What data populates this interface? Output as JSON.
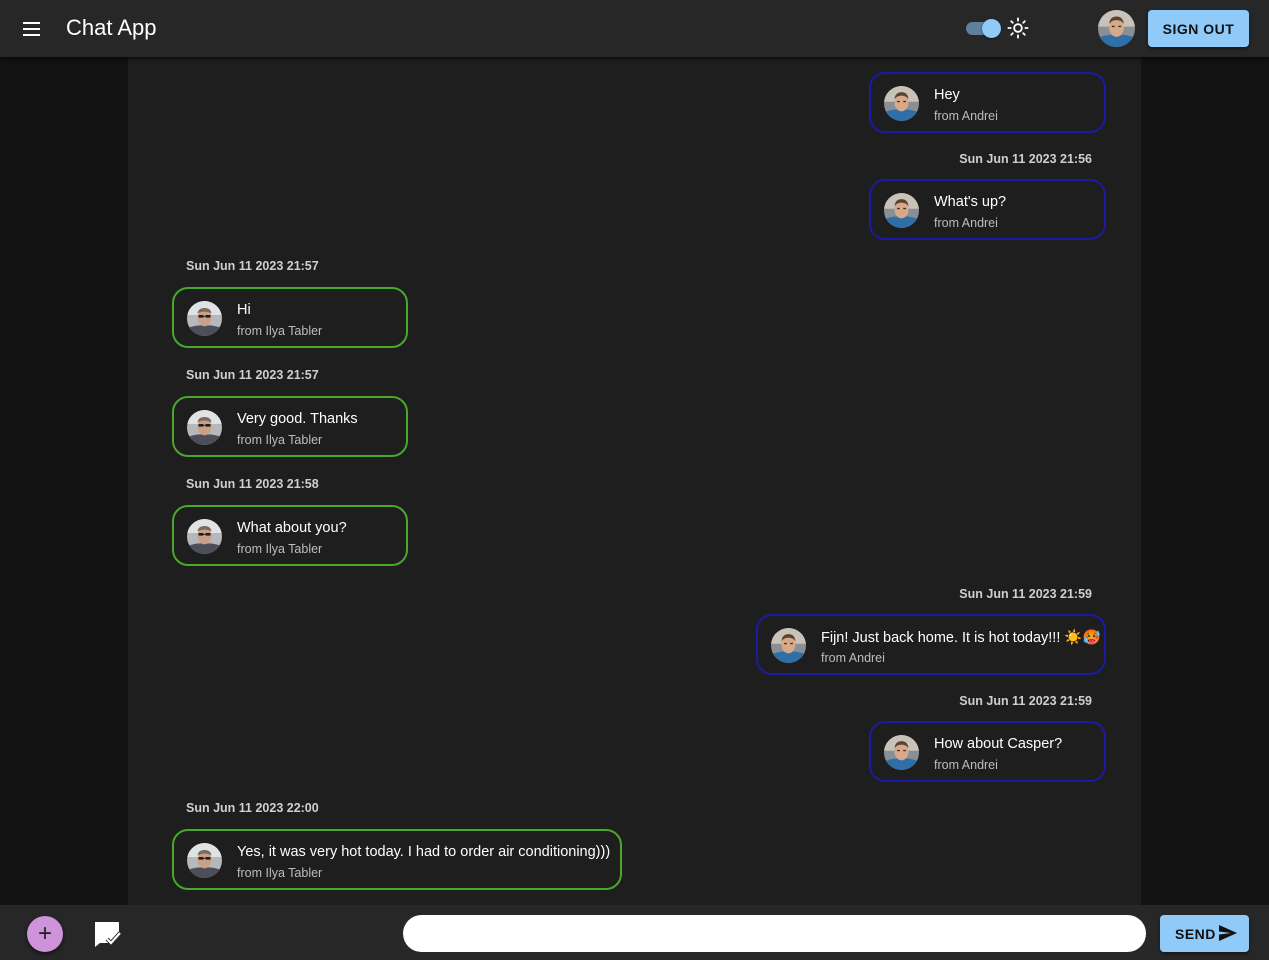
{
  "app": {
    "title": "Chat App"
  },
  "header": {
    "sign_out_label": "SIGN OUT",
    "theme_toggle": "on",
    "theme_icon": "sun-icon"
  },
  "messages": [
    {
      "id": "m1",
      "side": "mine",
      "timestamp": "",
      "text": "Hey",
      "from": "from Andrei"
    },
    {
      "id": "m2",
      "side": "mine",
      "timestamp": "Sun Jun 11 2023 21:56",
      "text": "What's up?",
      "from": "from Andrei"
    },
    {
      "id": "m3",
      "side": "theirs",
      "timestamp": "Sun Jun 11 2023 21:57",
      "text": "Hi",
      "from": "from Ilya Tabler"
    },
    {
      "id": "m4",
      "side": "theirs",
      "timestamp": "Sun Jun 11 2023 21:57",
      "text": "Very good. Thanks",
      "from": "from Ilya Tabler"
    },
    {
      "id": "m5",
      "side": "theirs",
      "timestamp": "Sun Jun 11 2023 21:58",
      "text": "What about you?",
      "from": "from Ilya Tabler"
    },
    {
      "id": "m6",
      "side": "mine",
      "timestamp": "Sun Jun 11 2023 21:59",
      "text": "Fijn! Just back home. It is hot today!!! ☀️🥵",
      "from": "from Andrei"
    },
    {
      "id": "m7",
      "side": "mine",
      "timestamp": "Sun Jun 11 2023 21:59",
      "text": "How about Casper?",
      "from": "from Andrei"
    },
    {
      "id": "m8",
      "side": "theirs",
      "timestamp": "Sun Jun 11 2023 22:00",
      "text": "Yes, it was very hot today. I had to order air conditioning)))",
      "from": "from Ilya Tabler"
    }
  ],
  "composer": {
    "input_value": "",
    "placeholder": "",
    "send_label": "SEND",
    "add_icon": "plus-icon",
    "chat_icon": "chat-check-icon"
  },
  "colors": {
    "mine_border": "#1a1aa6",
    "theirs_border": "#47a82c",
    "accent": "#90caf9",
    "fab": "#ce93d8"
  }
}
